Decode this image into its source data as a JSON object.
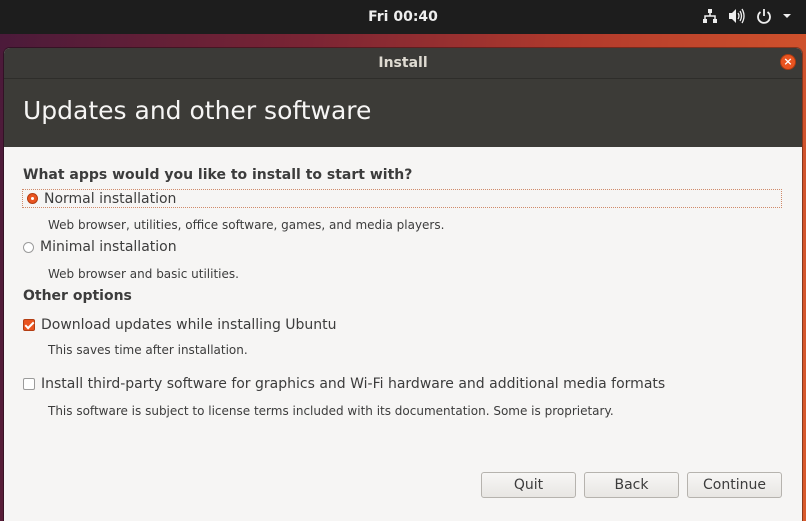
{
  "topbar": {
    "clock": "Fri 00:40",
    "icons": [
      "network-icon",
      "volume-icon",
      "power-icon",
      "menu-arrow-icon"
    ]
  },
  "window": {
    "title": "Install",
    "close_glyph": "×"
  },
  "header": {
    "title": "Updates and other software"
  },
  "install_type": {
    "question": "What apps would you like to install to start with?",
    "options": [
      {
        "label": "Normal installation",
        "description": "Web browser, utilities, office software, games, and media players.",
        "selected": true
      },
      {
        "label": "Minimal installation",
        "description": "Web browser and basic utilities.",
        "selected": false
      }
    ]
  },
  "other_options": {
    "heading": "Other options",
    "items": [
      {
        "label": "Download updates while installing Ubuntu",
        "description": "This saves time after installation.",
        "checked": true
      },
      {
        "label": "Install third-party software for graphics and Wi-Fi hardware and additional media formats",
        "description": "This software is subject to license terms included with its documentation. Some is proprietary.",
        "checked": false
      }
    ]
  },
  "buttons": {
    "quit": "Quit",
    "back": "Back",
    "continue": "Continue"
  },
  "colors": {
    "accent": "#e95420",
    "header_bg": "#3c3b37",
    "window_bg": "#f6f5f4"
  }
}
